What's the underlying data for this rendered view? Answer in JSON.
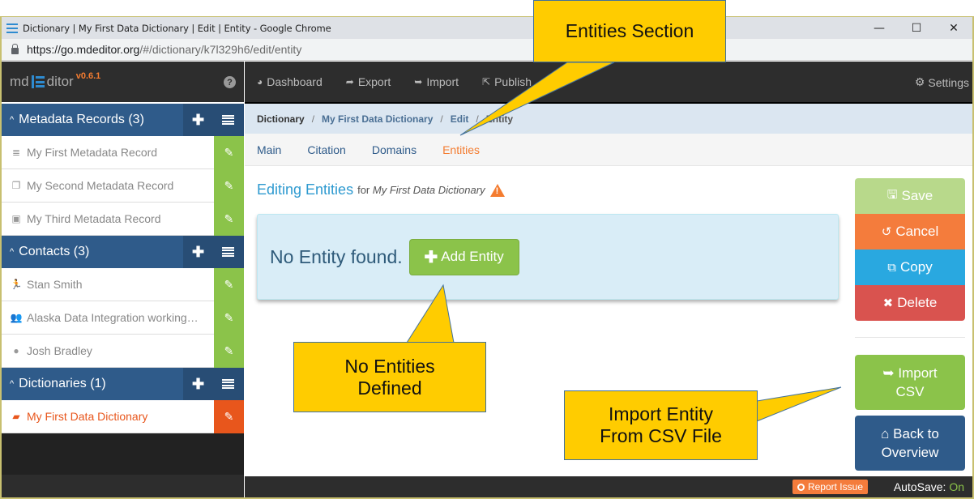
{
  "browser": {
    "title": "Dictionary | My First Data Dictionary | Edit | Entity - Google Chrome",
    "url_host": "https://go.mdeditor.org",
    "url_path": "/#/dictionary/k7l329h6/edit/entity",
    "controls": {
      "minimize": "—",
      "maximize": "☐",
      "close": "✕"
    }
  },
  "brand": {
    "prefix": "md",
    "suffix": "ditor",
    "version": "v0.6.1",
    "help": "?"
  },
  "sidebar": {
    "sections": [
      {
        "title": "Metadata Records (3)",
        "items": [
          {
            "label": "My First Metadata Record",
            "icon": "database-icon"
          },
          {
            "label": "My Second Metadata Record",
            "icon": "clone-icon"
          },
          {
            "label": "My Third Metadata Record",
            "icon": "image-icon"
          }
        ]
      },
      {
        "title": "Contacts (3)",
        "items": [
          {
            "label": "Stan Smith",
            "icon": "custom-avatar-icon"
          },
          {
            "label": "Alaska Data Integration working…",
            "icon": "users-icon"
          },
          {
            "label": "Josh Bradley",
            "icon": "user-icon"
          }
        ]
      },
      {
        "title": "Dictionaries (1)",
        "items": [
          {
            "label": "My First Data Dictionary",
            "icon": "book-icon",
            "active": true
          }
        ]
      }
    ]
  },
  "topnav": {
    "items": [
      "Dashboard",
      "Export",
      "Import",
      "Publish"
    ],
    "settings": "Settings"
  },
  "breadcrumb": {
    "root": "Dictionary",
    "links": [
      "My First Data Dictionary",
      "Edit"
    ],
    "current": "Entity",
    "separator": "/"
  },
  "tabs": [
    {
      "label": "Main",
      "active": false
    },
    {
      "label": "Citation",
      "active": false
    },
    {
      "label": "Domains",
      "active": false
    },
    {
      "label": "Entities",
      "active": true
    }
  ],
  "page": {
    "heading": "Editing Entities",
    "for_label": "for",
    "for_name": "My First Data Dictionary",
    "empty_message": "No Entity found.",
    "add_button": "Add Entity"
  },
  "actions": {
    "save": "Save",
    "cancel": "Cancel",
    "copy": "Copy",
    "delete": "Delete",
    "import_line1": "Import",
    "import_line2": "CSV",
    "back_line1": "Back to",
    "back_line2": "Overview"
  },
  "footer": {
    "report_issue": "Report Issue",
    "autosave_label": "AutoSave:",
    "autosave_value": "On"
  },
  "callouts": {
    "entities_section": "Entities Section",
    "no_entities_line1": "No Entities",
    "no_entities_line2": "Defined",
    "import_line1": "Import Entity",
    "import_line2": "From CSV File"
  },
  "colors": {
    "primary": "#2f5b8a",
    "success": "#8bc34a",
    "accent": "#f47c30",
    "info": "#29a8e0",
    "danger": "#d9534f",
    "callout": "#ffcc00"
  }
}
